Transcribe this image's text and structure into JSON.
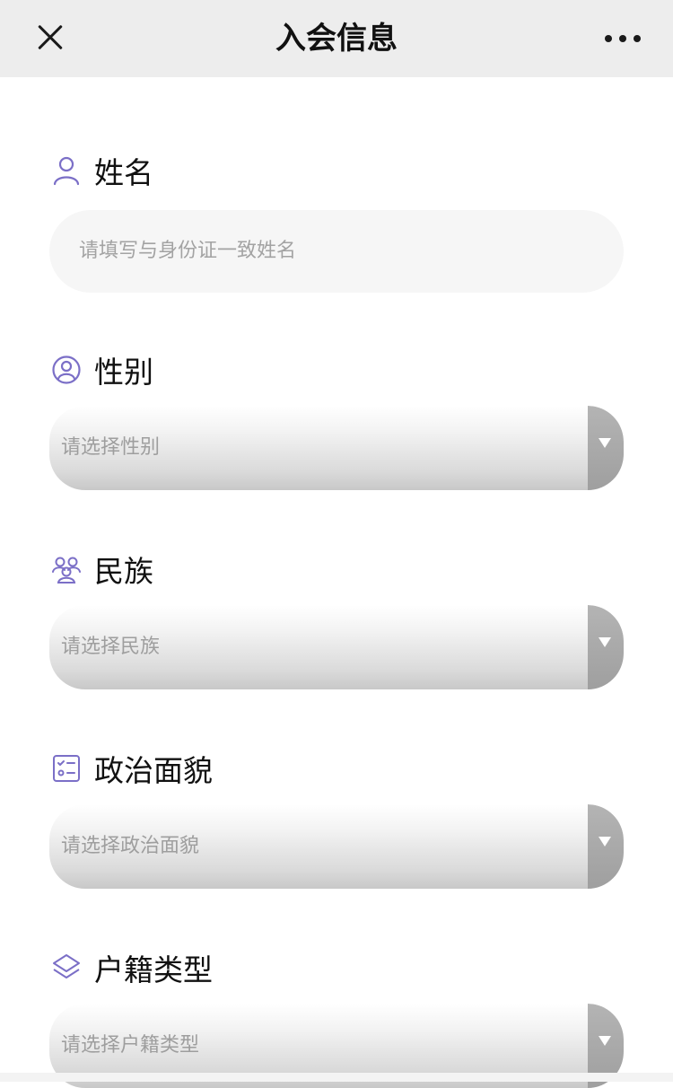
{
  "header": {
    "title": "入会信息",
    "close_icon": "close-icon",
    "more_icon": "more-icon"
  },
  "form": {
    "fields": [
      {
        "label": "姓名",
        "icon": "person-icon",
        "type": "text",
        "placeholder": "请填写与身份证一致姓名"
      },
      {
        "label": "性别",
        "icon": "user-circle-icon",
        "type": "select",
        "placeholder": "请选择性别"
      },
      {
        "label": "民族",
        "icon": "group-icon",
        "type": "select",
        "placeholder": "请选择民族"
      },
      {
        "label": "政治面貌",
        "icon": "checklist-icon",
        "type": "select",
        "placeholder": "请选择政治面貌"
      },
      {
        "label": "户籍类型",
        "icon": "layers-icon",
        "type": "select",
        "placeholder": "请选择户籍类型"
      }
    ]
  },
  "colors": {
    "accent_icon": "#7b6fc7",
    "header_bg": "#ededed",
    "input_bg": "#f6f6f6",
    "placeholder": "#a3a3a3"
  }
}
